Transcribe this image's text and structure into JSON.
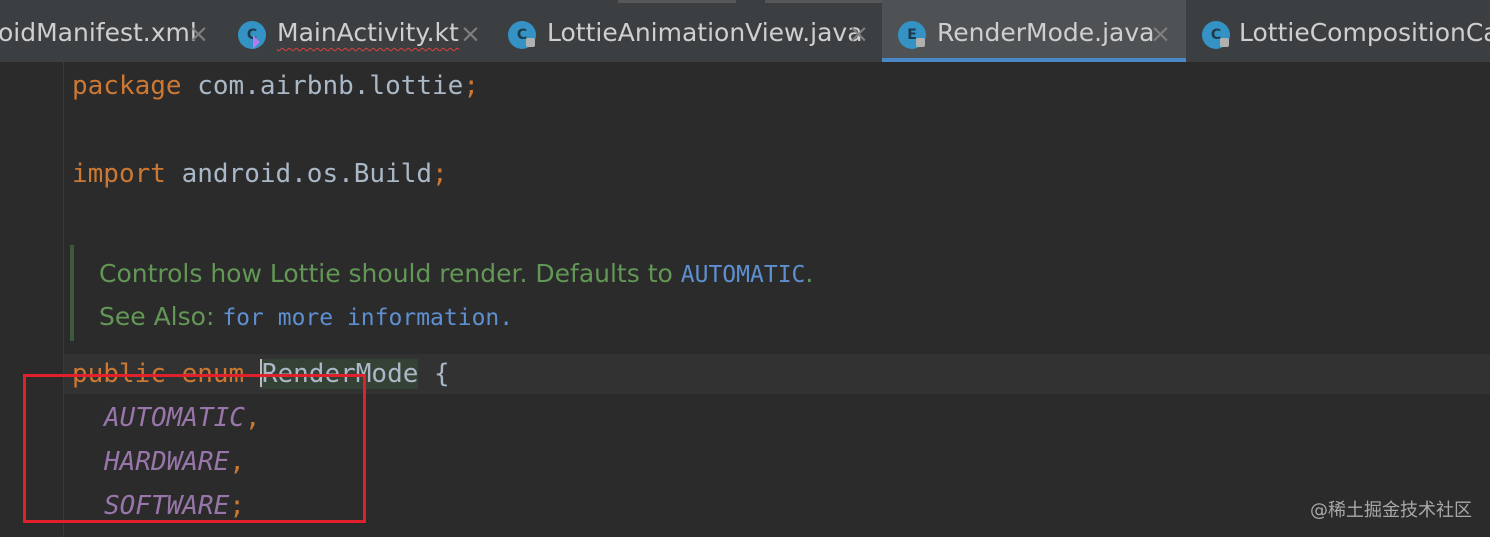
{
  "tabs": [
    {
      "label": "oidManifest.xml",
      "icon": "xml-file-icon",
      "active": false
    },
    {
      "label": "MainActivity.kt",
      "icon": "kotlin-class-icon",
      "active": false
    },
    {
      "label": "LottieAnimationView.java",
      "icon": "java-class-icon",
      "active": false
    },
    {
      "label": "RenderMode.java",
      "icon": "java-enum-icon",
      "active": true
    },
    {
      "label": "LottieCompositionCac",
      "icon": "java-class-icon",
      "active": false
    }
  ],
  "tab_icon_letters": {
    "class": "C",
    "enum": "E"
  },
  "close_glyph": "×",
  "code": {
    "line1": {
      "kw": "package",
      "rest": " com.airbnb.lottie",
      "semi": ";"
    },
    "line2": {
      "kw": "import",
      "rest": " android.os.Build",
      "semi": ";"
    },
    "doc1": {
      "text": "Controls how Lottie should render. Defaults to ",
      "ref": "AUTOMATIC",
      "end": "."
    },
    "doc2": {
      "text": "See Also: ",
      "ref": "for more information."
    },
    "enum_decl": {
      "kw": "public enum ",
      "name_first": "R",
      "name_rest": "enderMode",
      "brace": " {"
    },
    "constants": [
      {
        "name": "AUTOMATIC",
        "punct": ","
      },
      {
        "name": "HARDWARE",
        "punct": ","
      },
      {
        "name": "SOFTWARE",
        "punct": ";"
      }
    ]
  },
  "watermark": "@稀土掘金技术社区",
  "colors": {
    "background": "#2b2b2b",
    "keyword": "#cc7832",
    "enum_constant": "#9876aa",
    "doc_comment": "#629755",
    "annotation_box": "#e0202a",
    "active_tab_underline": "#4a88c7"
  }
}
